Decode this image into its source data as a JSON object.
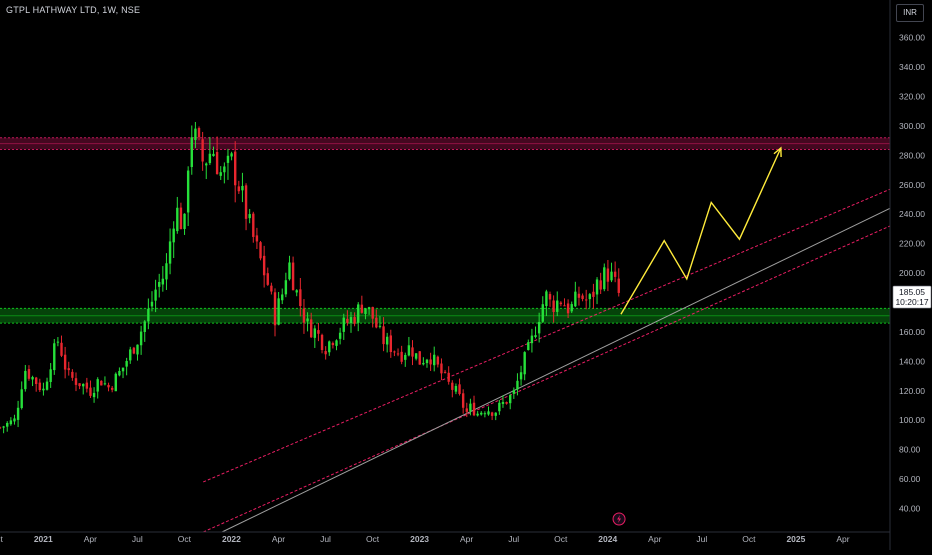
{
  "header": {
    "title": "GTPL HATHWAY LTD, 1W, NSE",
    "currency": "INR"
  },
  "price_label": {
    "price": "185.05",
    "countdown": "10:20:17"
  },
  "colors": {
    "up": "#26e03a",
    "down": "#e8262e",
    "resistance": "#c2185b",
    "support": "#0fbf1c",
    "channel": "#e91e63",
    "midline": "#9e9e9e",
    "projection": "#ffeb3b",
    "axis_text": "#b2b5be"
  },
  "icons": {
    "event": "lightning-icon"
  },
  "chart_data": {
    "type": "candlestick",
    "xlim": [
      2020.77,
      2025.5
    ],
    "ylim": [
      24,
      372
    ],
    "y_ticks": [
      40,
      60,
      80,
      100,
      120,
      140,
      160,
      180,
      200,
      220,
      240,
      260,
      280,
      300,
      320,
      340,
      360
    ],
    "y_tick_labels": [
      "40.00",
      "60.00",
      "80.00",
      "100.00",
      "120.00",
      "140.00",
      "160.00",
      "180.00",
      "200.00",
      "220.00",
      "240.00",
      "260.00",
      "280.00",
      "300.00",
      "320.00",
      "340.00",
      "360.00"
    ],
    "x_ticks": [
      {
        "label": "Oct",
        "t": 2020.75
      },
      {
        "label": "2021",
        "t": 2021.0
      },
      {
        "label": "Apr",
        "t": 2021.25
      },
      {
        "label": "Jul",
        "t": 2021.5
      },
      {
        "label": "Oct",
        "t": 2021.75
      },
      {
        "label": "2022",
        "t": 2022.0
      },
      {
        "label": "Apr",
        "t": 2022.25
      },
      {
        "label": "Jul",
        "t": 2022.5
      },
      {
        "label": "Oct",
        "t": 2022.75
      },
      {
        "label": "2023",
        "t": 2023.0
      },
      {
        "label": "Apr",
        "t": 2023.25
      },
      {
        "label": "Jul",
        "t": 2023.5
      },
      {
        "label": "Oct",
        "t": 2023.75
      },
      {
        "label": "2024",
        "t": 2024.0
      },
      {
        "label": "Apr",
        "t": 2024.25
      },
      {
        "label": "Jul",
        "t": 2024.5
      },
      {
        "label": "Oct",
        "t": 2024.75
      },
      {
        "label": "2025",
        "t": 2025.0
      },
      {
        "label": "Apr",
        "t": 2025.25
      }
    ],
    "price_path": [
      [
        2020.77,
        95
      ],
      [
        2020.85,
        100
      ],
      [
        2020.9,
        135
      ],
      [
        2020.97,
        125
      ],
      [
        2021.0,
        120
      ],
      [
        2021.04,
        140
      ],
      [
        2021.08,
        155
      ],
      [
        2021.13,
        130
      ],
      [
        2021.2,
        125
      ],
      [
        2021.25,
        120
      ],
      [
        2021.3,
        128
      ],
      [
        2021.35,
        122
      ],
      [
        2021.42,
        135
      ],
      [
        2021.5,
        155
      ],
      [
        2021.55,
        170
      ],
      [
        2021.6,
        190
      ],
      [
        2021.65,
        200
      ],
      [
        2021.7,
        245
      ],
      [
        2021.75,
        230
      ],
      [
        2021.78,
        300
      ],
      [
        2021.81,
        290
      ],
      [
        2021.85,
        275
      ],
      [
        2021.9,
        285
      ],
      [
        2021.95,
        265
      ],
      [
        2022.0,
        275
      ],
      [
        2022.04,
        260
      ],
      [
        2022.1,
        230
      ],
      [
        2022.15,
        210
      ],
      [
        2022.2,
        190
      ],
      [
        2022.23,
        170
      ],
      [
        2022.28,
        190
      ],
      [
        2022.3,
        210
      ],
      [
        2022.35,
        185
      ],
      [
        2022.4,
        165
      ],
      [
        2022.45,
        160
      ],
      [
        2022.5,
        150
      ],
      [
        2022.55,
        158
      ],
      [
        2022.6,
        165
      ],
      [
        2022.65,
        170
      ],
      [
        2022.7,
        180
      ],
      [
        2022.75,
        170
      ],
      [
        2022.8,
        155
      ],
      [
        2022.85,
        150
      ],
      [
        2022.9,
        145
      ],
      [
        2022.95,
        150
      ],
      [
        2023.0,
        140
      ],
      [
        2023.05,
        145
      ],
      [
        2023.1,
        135
      ],
      [
        2023.15,
        125
      ],
      [
        2023.2,
        118
      ],
      [
        2023.25,
        105
      ],
      [
        2023.28,
        110
      ],
      [
        2023.3,
        104
      ],
      [
        2023.35,
        108
      ],
      [
        2023.4,
        106
      ],
      [
        2023.45,
        112
      ],
      [
        2023.5,
        118
      ],
      [
        2023.55,
        138
      ],
      [
        2023.6,
        155
      ],
      [
        2023.63,
        170
      ],
      [
        2023.67,
        185
      ],
      [
        2023.7,
        178
      ],
      [
        2023.75,
        182
      ],
      [
        2023.8,
        175
      ],
      [
        2023.85,
        185
      ],
      [
        2023.9,
        180
      ],
      [
        2023.95,
        195
      ],
      [
        2024.0,
        200
      ],
      [
        2024.03,
        195
      ],
      [
        2024.06,
        185
      ]
    ],
    "resistance_zone": [
      284,
      292
    ],
    "support_zone": [
      166,
      176
    ],
    "channel_lower": [
      [
        2021.85,
        24
      ],
      [
        2025.5,
        232
      ]
    ],
    "channel_upper": [
      [
        2021.85,
        58
      ],
      [
        2025.5,
        257
      ]
    ],
    "channel_mid": [
      [
        2021.95,
        24
      ],
      [
        2025.5,
        244
      ]
    ],
    "projection": [
      [
        2024.07,
        172
      ],
      [
        2024.3,
        222
      ],
      [
        2024.42,
        196
      ],
      [
        2024.55,
        248
      ],
      [
        2024.7,
        223
      ],
      [
        2024.92,
        285
      ]
    ],
    "event_marker_t": 2024.06
  }
}
